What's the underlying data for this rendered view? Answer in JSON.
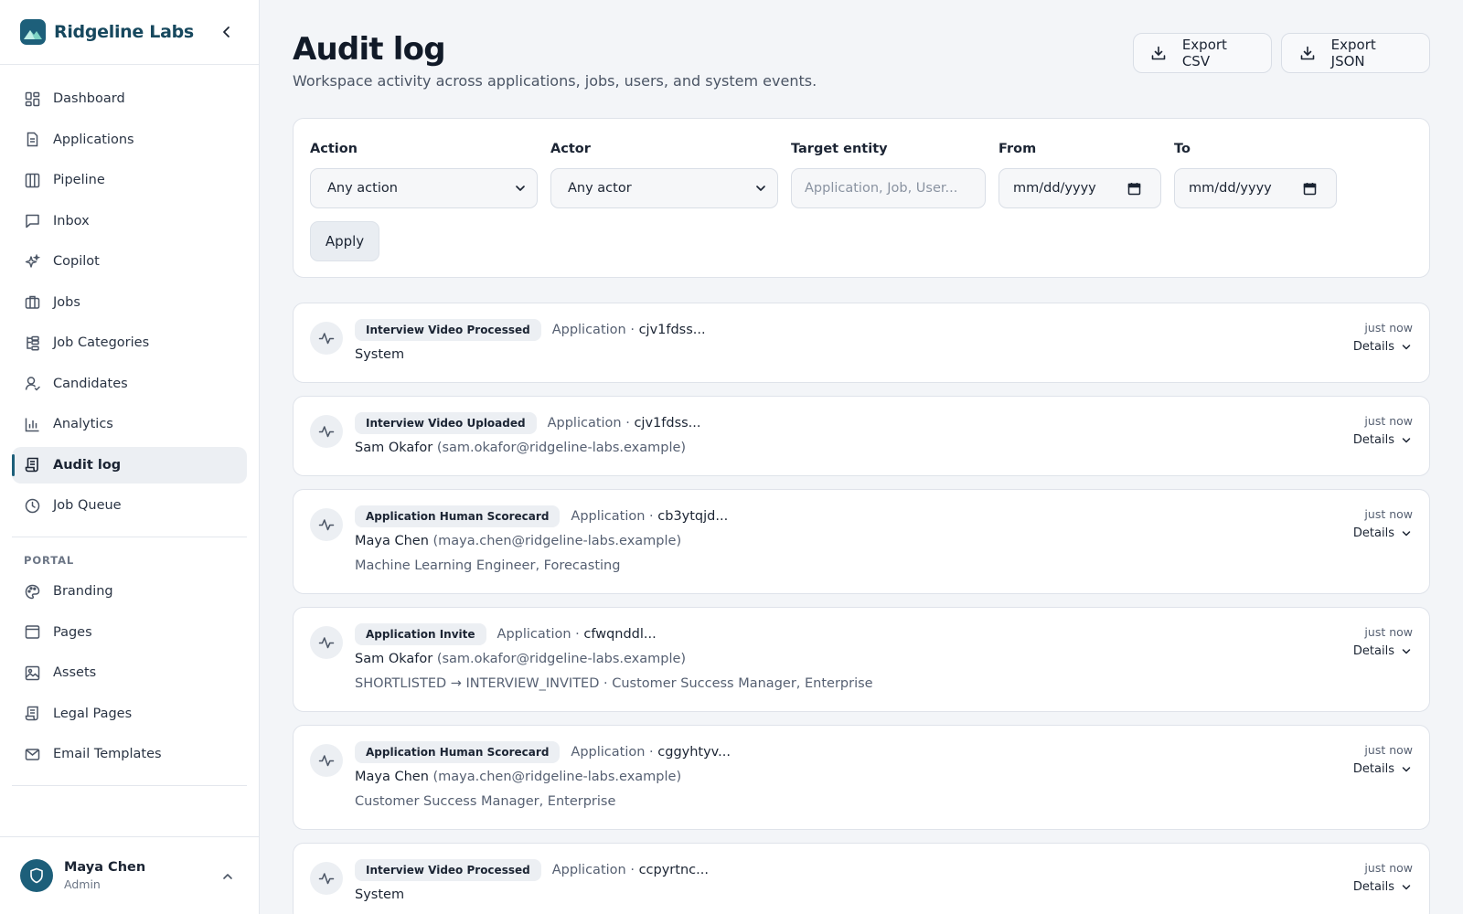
{
  "brand": {
    "name": "Ridgeline Labs"
  },
  "nav": {
    "items": [
      {
        "label": "Dashboard",
        "icon": "grid-icon"
      },
      {
        "label": "Applications",
        "icon": "document-icon"
      },
      {
        "label": "Pipeline",
        "icon": "columns-icon"
      },
      {
        "label": "Inbox",
        "icon": "message-icon"
      },
      {
        "label": "Copilot",
        "icon": "sparkle-icon"
      },
      {
        "label": "Jobs",
        "icon": "briefcase-icon"
      },
      {
        "label": "Job Categories",
        "icon": "hierarchy-icon"
      },
      {
        "label": "Candidates",
        "icon": "user-icon"
      },
      {
        "label": "Analytics",
        "icon": "bar-chart-icon"
      },
      {
        "label": "Audit log",
        "icon": "scroll-icon",
        "active": true
      },
      {
        "label": "Job Queue",
        "icon": "clock-icon"
      }
    ],
    "portal_label": "PORTAL",
    "portal_items": [
      {
        "label": "Branding",
        "icon": "palette-icon"
      },
      {
        "label": "Pages",
        "icon": "window-icon"
      },
      {
        "label": "Assets",
        "icon": "image-icon"
      },
      {
        "label": "Legal Pages",
        "icon": "scroll-icon"
      },
      {
        "label": "Email Templates",
        "icon": "mail-icon"
      }
    ]
  },
  "user": {
    "name": "Maya Chen",
    "role": "Admin"
  },
  "header": {
    "title": "Audit log",
    "subtitle": "Workspace activity across applications, jobs, users, and system events.",
    "export_csv": "Export CSV",
    "export_json": "Export JSON"
  },
  "filters": {
    "action_label": "Action",
    "action_value": "Any action",
    "actor_label": "Actor",
    "actor_value": "Any actor",
    "target_label": "Target entity",
    "target_placeholder": "Application, Job, User...",
    "from_label": "From",
    "from_value": "mm/dd/yyyy",
    "to_label": "To",
    "to_value": "mm/dd/yyyy",
    "apply": "Apply"
  },
  "entries": [
    {
      "badge": "Interview Video Processed",
      "target_type": "Application",
      "target_id": "cjv1fdss...",
      "actor": "System",
      "email": "",
      "extra": "",
      "time": "just now",
      "details": "Details"
    },
    {
      "badge": "Interview Video Uploaded",
      "target_type": "Application",
      "target_id": "cjv1fdss...",
      "actor": "Sam Okafor",
      "email": "(sam.okafor@ridgeline-labs.example)",
      "extra": "",
      "time": "just now",
      "details": "Details"
    },
    {
      "badge": "Application Human Scorecard",
      "target_type": "Application",
      "target_id": "cb3ytqjd...",
      "actor": "Maya Chen",
      "email": "(maya.chen@ridgeline-labs.example)",
      "extra": "Machine Learning Engineer, Forecasting",
      "time": "just now",
      "details": "Details"
    },
    {
      "badge": "Application Invite",
      "target_type": "Application",
      "target_id": "cfwqnddl...",
      "actor": "Sam Okafor",
      "email": "(sam.okafor@ridgeline-labs.example)",
      "extra": "SHORTLISTED → INTERVIEW_INVITED · Customer Success Manager, Enterprise",
      "time": "just now",
      "details": "Details"
    },
    {
      "badge": "Application Human Scorecard",
      "target_type": "Application",
      "target_id": "cggyhtyv...",
      "actor": "Maya Chen",
      "email": "(maya.chen@ridgeline-labs.example)",
      "extra": "Customer Success Manager, Enterprise",
      "time": "just now",
      "details": "Details"
    },
    {
      "badge": "Interview Video Processed",
      "target_type": "Application",
      "target_id": "ccpyrtnc...",
      "actor": "System",
      "email": "",
      "extra": "",
      "time": "just now",
      "details": "Details"
    }
  ],
  "colors": {
    "accent": "#1d5f7a",
    "background": "#f3f5f8",
    "card": "#ffffff"
  }
}
